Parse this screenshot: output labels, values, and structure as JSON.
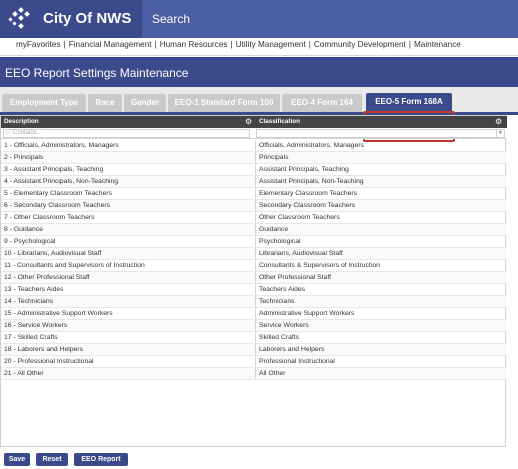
{
  "app": {
    "title": "City Of NWS",
    "logo_icon": "city-logo-icon"
  },
  "search": {
    "placeholder": "Search"
  },
  "nav": {
    "items": [
      "myFavorites",
      "Financial Management",
      "Human Resources",
      "Utility Management",
      "Community Development",
      "Maintenance"
    ],
    "separator": "|"
  },
  "page": {
    "title": "EEO Report Settings Maintenance"
  },
  "tabs": [
    {
      "label": "Employment Type",
      "active": false
    },
    {
      "label": "Race",
      "active": false
    },
    {
      "label": "Gender",
      "active": false
    },
    {
      "label": "EEO-1 Standard Form 100",
      "active": false
    },
    {
      "label": "EEO-4 Form 164",
      "active": false
    },
    {
      "label": "EEO-5 Form 168A",
      "active": true
    }
  ],
  "grid": {
    "columns": {
      "description": "Description",
      "classification": "Classification"
    },
    "filter_placeholder": "Contains...",
    "rows": [
      {
        "description": "1 - Officials, Administrators, Managers",
        "classification": "Officials, Administrators, Managers"
      },
      {
        "description": "2 - Principals",
        "classification": "Principals"
      },
      {
        "description": "3 - Assistant Principals, Teaching",
        "classification": "Assistant Principals, Teaching"
      },
      {
        "description": "4 - Assistant Principals, Non-Teaching",
        "classification": "Assistant Principals, Non-Teaching"
      },
      {
        "description": "5 - Elementary Classroom Teachers",
        "classification": "Elementary Classroom Teachers"
      },
      {
        "description": "6 - Secondary Classroom Teachers",
        "classification": "Secondary Classroom Teachers"
      },
      {
        "description": "7 - Other Classroom Teachers",
        "classification": "Other Classroom Teachers"
      },
      {
        "description": "8 - Guidance",
        "classification": "Guidance"
      },
      {
        "description": "9 - Psychological",
        "classification": "Psychological"
      },
      {
        "description": "10 - Librarians, Audiovisual Staff",
        "classification": "Librarians, Audiovisual Staff"
      },
      {
        "description": "11 - Consultants and Supervisors of Instruction",
        "classification": "Consultants & Supervisors of Instruction"
      },
      {
        "description": "12 - Other Professional Staff",
        "classification": "Other Professional Staff"
      },
      {
        "description": "13 - Teachers Aides",
        "classification": "Teachers Aides"
      },
      {
        "description": "14 - Technicians",
        "classification": "Technicians"
      },
      {
        "description": "15 - Administrative Support Workers",
        "classification": "Administrative Support Workers"
      },
      {
        "description": "16 - Service Workers",
        "classification": "Service Workers"
      },
      {
        "description": "17 - Skilled Crafts",
        "classification": "Skilled Crafts"
      },
      {
        "description": "18 - Laborers and Helpers",
        "classification": "Laborers and Helpers"
      },
      {
        "description": "20 - Professional Instructional",
        "classification": "Professional Instructional"
      },
      {
        "description": "21 - All Other",
        "classification": "All Other"
      }
    ]
  },
  "buttons": {
    "save": "Save",
    "reset": "Reset",
    "eeo_report": "EEO Report"
  },
  "colors": {
    "brand": "#3a4a8a",
    "header_dark": "#444444",
    "highlight": "#c0392b"
  }
}
